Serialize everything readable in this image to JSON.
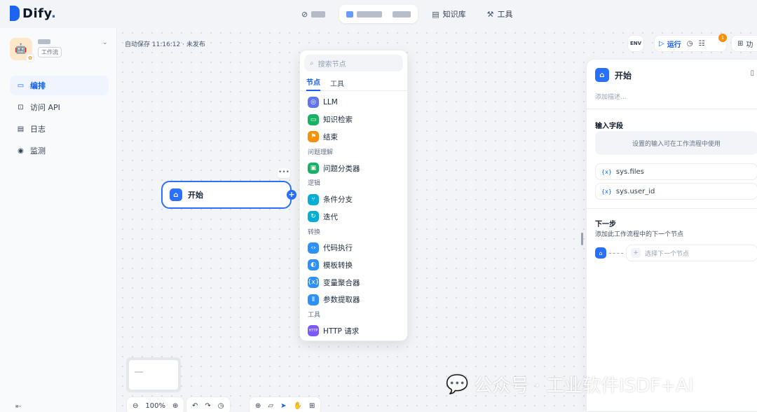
{
  "brand": {
    "name": "Dify",
    "dot": "."
  },
  "topnav": {
    "knowledge": "知识库",
    "tools": "工具"
  },
  "app": {
    "tag": "工作流",
    "icon": "robot-icon"
  },
  "sidebar": {
    "items": [
      {
        "label": "编排",
        "icon": "layout-icon",
        "active": true
      },
      {
        "label": "访问 API",
        "icon": "api-icon",
        "active": false
      },
      {
        "label": "日志",
        "icon": "log-icon",
        "active": false
      },
      {
        "label": "监测",
        "icon": "monitor-icon",
        "active": false
      }
    ]
  },
  "canvas": {
    "autosave": "自动保存 11:16:12 · 未发布",
    "start_node": {
      "label": "开始"
    },
    "node_more": "•••"
  },
  "toolbar": {
    "env": "ENV",
    "run": "运行",
    "notif_count": "1",
    "more": "功"
  },
  "picker": {
    "search_placeholder": "搜索节点",
    "tabs": [
      "节点",
      "工具"
    ],
    "items": [
      {
        "type": "item",
        "label": "LLM",
        "color": "#6172f3",
        "glyph": "◎"
      },
      {
        "type": "item",
        "label": "知识检索",
        "color": "#16b364",
        "glyph": "▭"
      },
      {
        "type": "item",
        "label": "结束",
        "color": "#f79009",
        "glyph": "⚑"
      },
      {
        "type": "group",
        "label": "问题理解"
      },
      {
        "type": "item",
        "label": "问题分类器",
        "color": "#16b364",
        "glyph": "▣"
      },
      {
        "type": "group",
        "label": "逻辑"
      },
      {
        "type": "item",
        "label": "条件分支",
        "color": "#06aed4",
        "glyph": "⑂"
      },
      {
        "type": "item",
        "label": "迭代",
        "color": "#06aed4",
        "glyph": "↻"
      },
      {
        "type": "group",
        "label": "转换"
      },
      {
        "type": "item",
        "label": "代码执行",
        "color": "#2e90fa",
        "glyph": "‹›"
      },
      {
        "type": "item",
        "label": "模板转换",
        "color": "#2e90fa",
        "glyph": "◐"
      },
      {
        "type": "item",
        "label": "变量聚合器",
        "color": "#2e90fa",
        "glyph": "{x}"
      },
      {
        "type": "item",
        "label": "参数提取器",
        "color": "#2e90fa",
        "glyph": "⦀"
      },
      {
        "type": "group",
        "label": "工具"
      },
      {
        "type": "item",
        "label": "HTTP 请求",
        "color": "#7a5af8",
        "glyph": "HTTP"
      }
    ]
  },
  "panel": {
    "title": "开始",
    "description_placeholder": "添加描述...",
    "input_section": "输入字段",
    "input_hint": "设置的输入可在工作流程中使用",
    "vars": [
      "sys.files",
      "sys.user_id"
    ],
    "var_icon": "{x}",
    "next_section": "下一步",
    "next_hint": "添加此工作流程中的下一个节点",
    "next_button": "选择下一个节点"
  },
  "bottom": {
    "zoom": "100%"
  },
  "watermark": "公众号 · 工业软件ISDF+AI"
}
